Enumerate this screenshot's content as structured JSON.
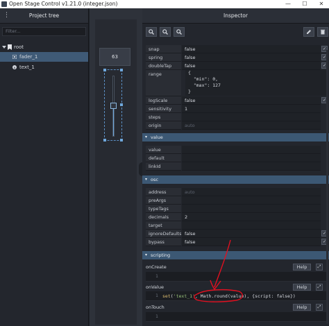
{
  "window": {
    "title": "Open Stage Control v1.21.0 (integer.json)",
    "minimize": "—",
    "maximize": "☐",
    "close": "✕"
  },
  "project_tree": {
    "header": "Project tree",
    "menu": "⋮",
    "filter_placeholder": "Filter...",
    "items": [
      {
        "label": "root"
      },
      {
        "label": "fader_1"
      },
      {
        "label": "text_1"
      }
    ]
  },
  "canvas": {
    "fader_value": "63",
    "fader_level": 0.5
  },
  "inspector": {
    "header": "Inspector",
    "tools": {
      "zoom_in": "🔍",
      "zoom_out": "🔍",
      "zoom_reset": "🔍",
      "edit": "✎",
      "trash": "🗑"
    },
    "props_top": [
      {
        "key": "snap",
        "value": "false"
      },
      {
        "key": "spring",
        "value": "false"
      },
      {
        "key": "doubleTap",
        "value": "false"
      }
    ],
    "range": {
      "key": "range",
      "value": "{\n  \"min\": 0,\n  \"max\": 127\n}"
    },
    "props_mid": [
      {
        "key": "logScale",
        "value": "false"
      },
      {
        "key": "sensitivity",
        "value": "1"
      },
      {
        "key": "steps",
        "value": ""
      },
      {
        "key": "origin",
        "value": "auto"
      }
    ],
    "section_value": "value",
    "props_value": [
      {
        "key": "value",
        "value": ""
      },
      {
        "key": "default",
        "value": ""
      },
      {
        "key": "linkId",
        "value": ""
      }
    ],
    "section_osc": "osc",
    "props_osc": [
      {
        "key": "address",
        "value": "auto"
      },
      {
        "key": "preArgs",
        "value": ""
      },
      {
        "key": "typeTags",
        "value": ""
      },
      {
        "key": "decimals",
        "value": "2"
      },
      {
        "key": "target",
        "value": ""
      },
      {
        "key": "ignoreDefaults",
        "value": "false"
      },
      {
        "key": "bypass",
        "value": "false"
      }
    ],
    "section_scripting": "scripting",
    "scripts": {
      "onCreate": {
        "label": "onCreate",
        "line": "1",
        "code": ""
      },
      "onValue": {
        "label": "onValue",
        "line": "1",
        "code_fn": "set",
        "code_str": "'text_1'",
        "code_rest": ", Math.round(value), {script: false})"
      },
      "onTouch": {
        "label": "onTouch",
        "line": "1",
        "code": ""
      }
    },
    "help_label": "Help",
    "check_mark": "✓",
    "caret": "▾"
  }
}
